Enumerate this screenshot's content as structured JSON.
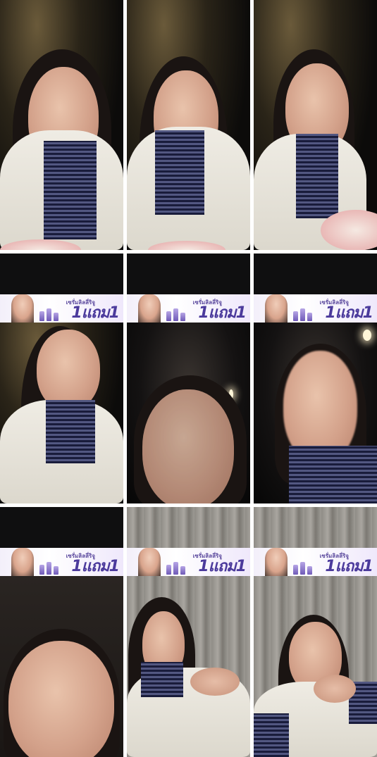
{
  "promo_banner": {
    "small_text": "เซรั่มลิลลี่ริจู",
    "big_text": "1แถม1"
  },
  "colors": {
    "banner_text": "#4b3a9c",
    "banner_bg": "#f3effa"
  }
}
